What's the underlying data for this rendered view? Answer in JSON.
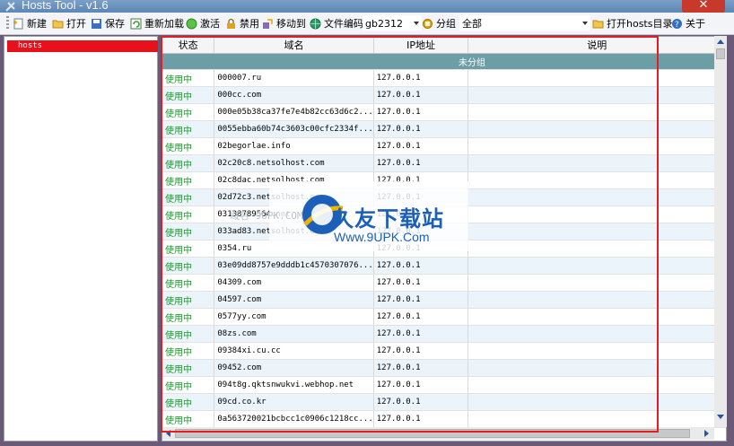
{
  "window": {
    "title": "Hosts Tool - v1.6",
    "close_glyph": "✕"
  },
  "toolbar": {
    "new": "新建",
    "open": "打开",
    "save": "保存",
    "reload": "重新加载",
    "activate": "激活",
    "disable": "禁用",
    "move_to": "移动到",
    "encoding_label": "文件编码",
    "encoding_value": "gb2312",
    "group_label": "分组",
    "group_value": "全部",
    "open_dir": "打开hosts目录",
    "about": "关于"
  },
  "sidebar": {
    "items": [
      {
        "label": "hosts",
        "selected": true
      }
    ]
  },
  "table": {
    "columns": [
      "状态",
      "域名",
      "IP地址",
      "说明"
    ],
    "group": "未分组",
    "rows": [
      [
        "使用中",
        "000007.ru",
        "127.0.0.1",
        ""
      ],
      [
        "使用中",
        "000cc.com",
        "127.0.0.1",
        ""
      ],
      [
        "使用中",
        "000e05b38ca37fe7e4b82cc63d6c2...",
        "127.0.0.1",
        ""
      ],
      [
        "使用中",
        "0055ebba60b74c3603c00cfc2334f...",
        "127.0.0.1",
        ""
      ],
      [
        "使用中",
        "02begorlae.info",
        "127.0.0.1",
        ""
      ],
      [
        "使用中",
        "02c20c8.netsolhost.com",
        "127.0.0.1",
        ""
      ],
      [
        "使用中",
        "02c8dac.netsolhost.com",
        "127.0.0.1",
        ""
      ],
      [
        "使用中",
        "02d72c3.netsolhost.com",
        "127.0.0.1",
        ""
      ],
      [
        "使用中",
        "03138789564.net",
        "127.0.0.1",
        ""
      ],
      [
        "使用中",
        "033ad83.netsolhost.com",
        "127.0.0.1",
        ""
      ],
      [
        "使用中",
        "0354.ru",
        "127.0.0.1",
        ""
      ],
      [
        "使用中",
        "03e09dd8757e9dddb1c4570307076...",
        "127.0.0.1",
        ""
      ],
      [
        "使用中",
        "04309.com",
        "127.0.0.1",
        ""
      ],
      [
        "使用中",
        "04597.com",
        "127.0.0.1",
        ""
      ],
      [
        "使用中",
        "0577yy.com",
        "127.0.0.1",
        ""
      ],
      [
        "使用中",
        "08zs.com",
        "127.0.0.1",
        ""
      ],
      [
        "使用中",
        "09384xi.cu.cc",
        "127.0.0.1",
        ""
      ],
      [
        "使用中",
        "09452.com",
        "127.0.0.1",
        ""
      ],
      [
        "使用中",
        "094t8g.qktsnwukvi.webhop.net",
        "127.0.0.1",
        ""
      ],
      [
        "使用中",
        "09cd.co.kr",
        "127.0.0.1",
        ""
      ],
      [
        "使用中",
        "0a563720021bcbcc1c0906c1218cc...",
        "127.0.0.1",
        ""
      ]
    ]
  },
  "watermark": {
    "brand": "久友下载站",
    "url": "Www.9UPK.Com",
    "ghost": "域名 9UPK.COM"
  },
  "colors": {
    "status_active": "#1a9a2a",
    "selection": "#e8101a",
    "group_header": "#6b9fa5",
    "highlight_frame": "#e01e24"
  }
}
